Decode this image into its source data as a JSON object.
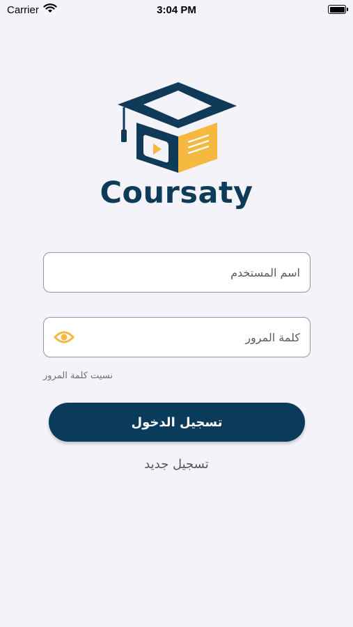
{
  "status_bar": {
    "carrier": "Carrier",
    "time": "3:04 PM"
  },
  "brand": {
    "name": "Coursaty",
    "colors": {
      "navy": "#0f3b58",
      "accent": "#f5b841"
    }
  },
  "form": {
    "username": {
      "placeholder": "اسم المستخدم",
      "value": ""
    },
    "password": {
      "placeholder": "كلمة المرور",
      "value": ""
    },
    "forgot_password": "نسيت كلمة المرور",
    "login_button": "تسجيل الدخول",
    "register_link": "تسجيل جديد"
  }
}
